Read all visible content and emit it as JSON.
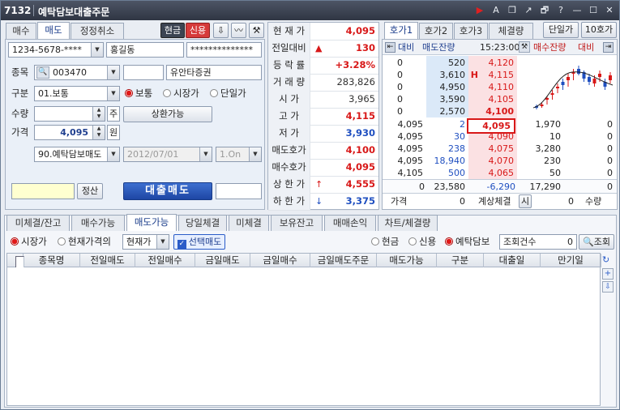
{
  "title": {
    "id": "7132",
    "name": "예탁담보대출주문"
  },
  "order_tabs": [
    "매수",
    "매도",
    "정정취소"
  ],
  "mode_buttons": {
    "cash": "현금",
    "credit": "신용"
  },
  "account": {
    "number": "1234-5678-****",
    "name": "홍길동",
    "password": "**************"
  },
  "form": {
    "stock_label": "종목",
    "stock_code": "003470",
    "stock_name": "유안타증권",
    "type_label": "구분",
    "type_value": "01.보통",
    "type_options": [
      "보통",
      "시장가",
      "단일가"
    ],
    "qty_label": "수량",
    "qty_unit": "주",
    "redeem_btn": "상환가능",
    "price_label": "가격",
    "price_value": "4,095",
    "price_unit": "원",
    "loan_type": "90.예탁담보매도",
    "loan_date": "2012/07/01",
    "loan_term": "1.On",
    "settle_btn": "정산",
    "submit_btn": "대출매도"
  },
  "price_info": [
    {
      "k": "현 재 가",
      "v": "4,095",
      "arrow": "",
      "color": "red"
    },
    {
      "k": "전일대비",
      "v": "130",
      "arrow": "▲",
      "color": "red"
    },
    {
      "k": "등 락 률",
      "v": "+3.28%",
      "arrow": "",
      "color": "red"
    },
    {
      "k": "거 래 량",
      "v": "283,826",
      "arrow": "",
      "color": "dark"
    },
    {
      "k": "시  가",
      "v": "3,965",
      "arrow": "",
      "color": "dark"
    },
    {
      "k": "고  가",
      "v": "4,115",
      "arrow": "",
      "color": "red"
    },
    {
      "k": "저  가",
      "v": "3,930",
      "arrow": "",
      "color": "blue"
    },
    {
      "k": "매도호가",
      "v": "4,100",
      "arrow": "",
      "color": "red"
    },
    {
      "k": "매수호가",
      "v": "4,095",
      "arrow": "",
      "color": "red"
    },
    {
      "k": "상 한 가",
      "v": "4,555",
      "arrow": "↑",
      "color": "red"
    },
    {
      "k": "하 한 가",
      "v": "3,375",
      "arrow": "↓",
      "color": "blue"
    }
  ],
  "orderbook": {
    "tabs": [
      "호가1",
      "호가2",
      "호가3",
      "체결량"
    ],
    "extra_tabs": [
      "단일가",
      "10호가"
    ],
    "header": {
      "prev_compare": "대비",
      "ask_qty": "매도잔량",
      "time": "15:23:00",
      "bid_qty": "매수잔량",
      "compare2": "대비"
    },
    "asks": [
      {
        "cmp": "0",
        "qty": "520",
        "price": "4,120"
      },
      {
        "cmp": "0",
        "qty": "3,610",
        "price": "4,115",
        "mark": "H"
      },
      {
        "cmp": "0",
        "qty": "4,950",
        "price": "4,110"
      },
      {
        "cmp": "0",
        "qty": "3,590",
        "price": "4,105"
      },
      {
        "cmp": "0",
        "qty": "2,570",
        "price": "4,100"
      }
    ],
    "bids": [
      {
        "left": "4,095",
        "ask": "2",
        "price": "4,095",
        "qty": "1,970",
        "cmp": "0"
      },
      {
        "left": "4,095",
        "ask": "30",
        "price": "4,090",
        "qty": "10",
        "cmp": "0"
      },
      {
        "left": "4,095",
        "ask": "238",
        "price": "4,075",
        "qty": "3,280",
        "cmp": "0"
      },
      {
        "left": "4,095",
        "ask": "18,940",
        "price": "4,070",
        "qty": "230",
        "cmp": "0"
      },
      {
        "left": "4,105",
        "ask": "500",
        "price": "4,065",
        "qty": "50",
        "cmp": "0"
      }
    ],
    "totals": {
      "cmp": "0",
      "ask": "23,580",
      "diff": "-6,290",
      "bid": "17,290",
      "cmp2": "0"
    },
    "footer": {
      "price_label": "가격",
      "price": "0",
      "calc_label": "계상체결",
      "calc_btn": "시",
      "qty": "0",
      "qty_label": "수량"
    }
  },
  "bottom": {
    "tabs": [
      "미체결/잔고",
      "매수가능",
      "매도가능",
      "당일체결",
      "미체결",
      "보유잔고",
      "매매손익",
      "차트/체결량"
    ],
    "price_opts": [
      "시장가",
      "현재가격의"
    ],
    "price_combo": "현재가",
    "select_sell": "선택매도",
    "asset_opts": [
      "현금",
      "신용",
      "예탁담보"
    ],
    "query_count_label": "조회건수",
    "query_count": "0",
    "query_btn": "조회",
    "columns": [
      "종목명",
      "전일매도",
      "전일매수",
      "금일매도",
      "금일매수",
      "금일매도주문",
      "매도가능",
      "구분",
      "대출일",
      "만기일"
    ]
  },
  "colors": {
    "ask_bg": "#dbe9f8",
    "bid_bg": "#fbe1e3",
    "accent": "#1f3f8f",
    "up": "#d81818",
    "down": "#1f4fc0"
  }
}
